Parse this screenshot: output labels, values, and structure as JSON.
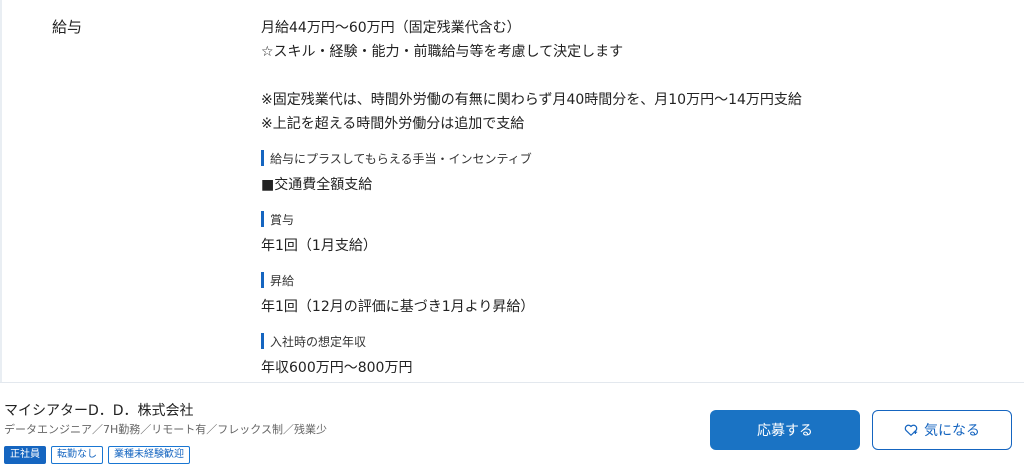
{
  "salary": {
    "label": "給与",
    "lines": [
      "月給44万円〜60万円（固定残業代含む）",
      "☆スキル・経験・能力・前職給与等を考慮して決定します",
      "",
      "※固定残業代は、時間外労働の有無に関わらず月40時間分を、月10万円〜14万円支給",
      "※上記を超える時間外労働分は追加で支給"
    ],
    "sections": [
      {
        "title": "給与にプラスしてもらえる手当・インセンティブ",
        "value": "■交通費全額支給"
      },
      {
        "title": "賞与",
        "value": "年1回（1月支給）"
      },
      {
        "title": "昇給",
        "value": "年1回（12月の評価に基づき1月より昇給）"
      },
      {
        "title": "入社時の想定年収",
        "value": "年収600万円〜800万円"
      }
    ]
  },
  "footer": {
    "company": "マイシアターD．D．株式会社",
    "summary": "データエンジニア／7H勤務／リモート有／フレックス制／残業少",
    "tags": [
      "正社員",
      "転勤なし",
      "業種未経験歓迎"
    ],
    "apply_label": "応募する",
    "favorite_label": "気になる"
  }
}
